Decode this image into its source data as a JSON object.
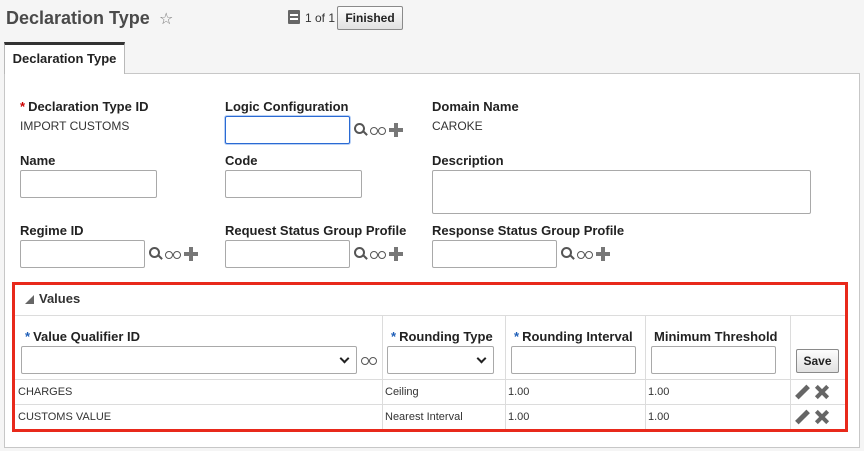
{
  "header": {
    "title": "Declaration Type",
    "star_icon": "star-icon",
    "pager_text": "1 of 1",
    "finished_label": "Finished"
  },
  "tab": {
    "label": "Declaration Type"
  },
  "form": {
    "declaration_type_id": {
      "label": "Declaration Type ID",
      "value": "IMPORT CUSTOMS",
      "required": true
    },
    "logic_configuration": {
      "label": "Logic Configuration",
      "value": ""
    },
    "domain_name": {
      "label": "Domain Name",
      "value": "CAROKE"
    },
    "name": {
      "label": "Name",
      "value": ""
    },
    "code": {
      "label": "Code",
      "value": ""
    },
    "description": {
      "label": "Description",
      "value": ""
    },
    "regime_id": {
      "label": "Regime ID",
      "value": ""
    },
    "request_status_group_profile": {
      "label": "Request Status Group Profile",
      "value": ""
    },
    "response_status_group_profile": {
      "label": "Response Status Group Profile",
      "value": ""
    }
  },
  "values_section": {
    "title": "Values",
    "columns": [
      {
        "label": "Value Qualifier ID",
        "required": true
      },
      {
        "label": "Rounding Type",
        "required": true
      },
      {
        "label": "Rounding Interval",
        "required": true
      },
      {
        "label": "Minimum Threshold",
        "required": false
      }
    ],
    "save_label": "Save",
    "rows": [
      {
        "qualifier": "CHARGES",
        "rounding_type": "Ceiling",
        "rounding_interval": "1.00",
        "minimum_threshold": "1.00"
      },
      {
        "qualifier": "CUSTOMS VALUE",
        "rounding_type": "Nearest Interval",
        "rounding_interval": "1.00",
        "minimum_threshold": "1.00"
      }
    ]
  },
  "colors": {
    "required_red": "#cc0000",
    "required_blue": "#1f5fb8",
    "highlight_border": "#e8291b",
    "focus_border": "#2a6ad3"
  }
}
